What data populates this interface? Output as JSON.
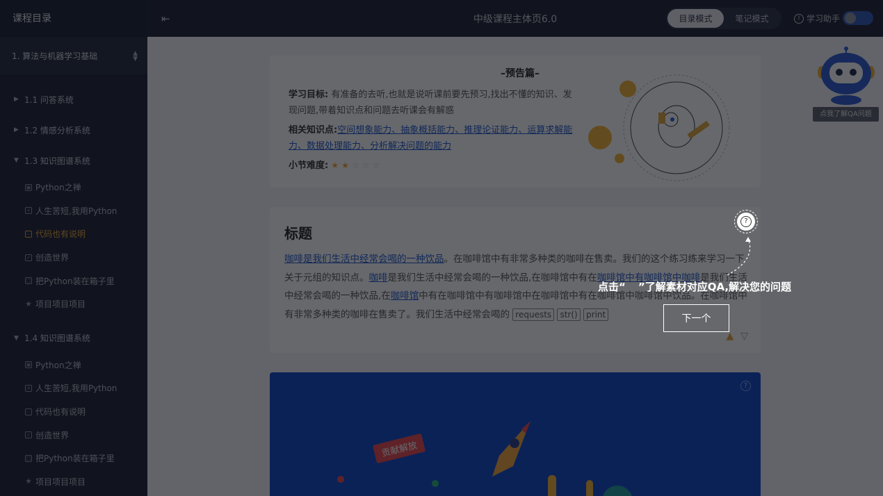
{
  "sidebar": {
    "title": "课程目录",
    "course_select": "1. 算法与机器学习基础",
    "groups": [
      {
        "label": "1.1 问答系统",
        "expanded": false,
        "items": []
      },
      {
        "label": "1.2 情感分析系统",
        "expanded": false,
        "items": []
      },
      {
        "label": "1.3 知识图谱系统",
        "expanded": true,
        "items": [
          {
            "label": "Python之禅",
            "icon": "image-icon"
          },
          {
            "label": "人生苦短,我用Python",
            "icon": "plus-box-icon"
          },
          {
            "label": "代码也有说明",
            "icon": "code-icon",
            "active": true
          },
          {
            "label": "创造世界",
            "icon": "check-box-icon"
          },
          {
            "label": "把Python装在箱子里",
            "icon": "box-icon"
          },
          {
            "label": "项目项目项目",
            "icon": "star-icon"
          }
        ]
      },
      {
        "label": "1.4 知识图谱系统",
        "expanded": true,
        "items": [
          {
            "label": "Python之禅",
            "icon": "image-icon"
          },
          {
            "label": "人生苦短,我用Python",
            "icon": "plus-box-icon"
          },
          {
            "label": "代码也有说明",
            "icon": "code-icon"
          },
          {
            "label": "创造世界",
            "icon": "check-box-icon"
          },
          {
            "label": "把Python装在箱子里",
            "icon": "box-icon"
          },
          {
            "label": "项目项目项目",
            "icon": "star-icon"
          }
        ]
      }
    ]
  },
  "topbar": {
    "page_title": "中级课程主体页6.0",
    "mode_catalog": "目录模式",
    "mode_notes": "笔记模式",
    "assistant_label": "学习助手"
  },
  "preview": {
    "title": "–预告篇–",
    "goal_label": "学习目标:",
    "goal_text": "有准备的去听,也就是说听课前要先预习,找出不懂的知识、发现问题,带着知识点和问题去听课会有解惑",
    "knowledge_label": "相关知识点:",
    "knowledge_links": [
      "空间想象能力",
      "抽象概括能力",
      "推理论证能力",
      "运算求解能力",
      "数据处理能力",
      "分析解决问题的能力"
    ],
    "difficulty_label": "小节难度:",
    "difficulty": 2,
    "difficulty_max": 5
  },
  "article": {
    "title": "标题",
    "p1_link": "咖啡是我们生活中经常会喝的一种饮品",
    "p1_text": "。在咖啡馆中有非常多种类的咖啡在售卖。我们的这个练习练来学习一下关于元组的知识点。",
    "p2_link": "咖啡",
    "p2_text": "是我们生活中经常会喝的一种饮品,在咖啡馆中有在",
    "p3_link": "咖啡馆中有咖啡馆中咖啡",
    "p3_text": "是我们生活中经常会喝的一种饮品,在",
    "p4_link": "咖啡馆",
    "p4_text": "中有在咖啡馆中有咖啡馆中在咖啡馆中有在咖啡馆中咖啡馆中饮品。在咖啡馆中有非常多种类的咖啡在售卖了。我们生活中经常会喝的",
    "codes": [
      "requests",
      "str()",
      "print"
    ]
  },
  "banner": {
    "tag": "贡献解放"
  },
  "robot": {
    "tip": "点我了解QA问题"
  },
  "guide": {
    "text_before": "点击“",
    "text_after": "”了解素材对应QA,解决您的问题",
    "next_label": "下一个"
  },
  "colors": {
    "accent": "#e8a33c",
    "link": "#1d58c8",
    "sidebar_bg": "#1d2433",
    "banner_bg": "#0f48c9"
  }
}
